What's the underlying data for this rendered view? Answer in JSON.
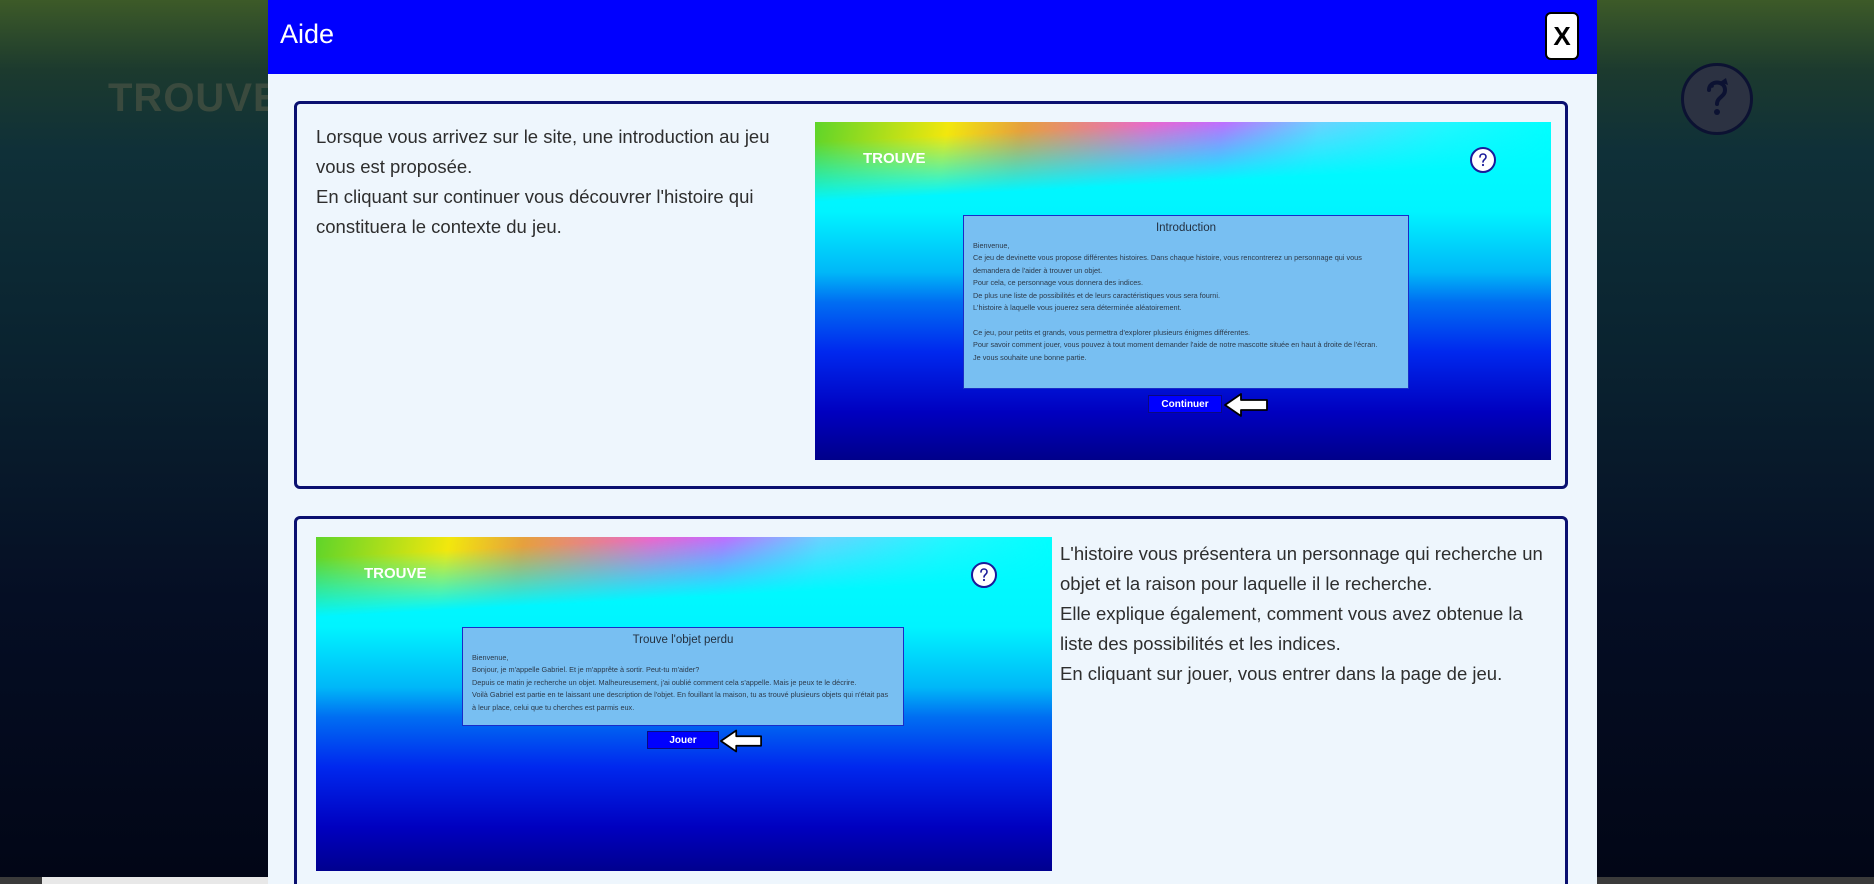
{
  "background": {
    "title": "TROUVE"
  },
  "modal": {
    "title": "Aide",
    "close_label": "X"
  },
  "sections": [
    {
      "paragraphs": [
        "Lorsque vous arrivez sur le site, une introduction au jeu vous est proposée.",
        "En cliquant sur continuer vous découvrer l'histoire qui constituera le contexte du jeu."
      ],
      "screenshot": {
        "brand": "TROUVE",
        "dialog_title": "Introduction",
        "dialog_lines": [
          "Bienvenue,",
          "Ce jeu de devinette vous propose différentes histoires. Dans chaque histoire, vous rencontrerez un personnage qui vous demandera de l'aider à trouver un objet.",
          "Pour cela, ce personnage vous donnera des indices.",
          "De plus une liste de possibilités et de leurs caractéristiques vous sera fourni.",
          "L'histoire à laquelle vous jouerez sera déterminée aléatoirement.",
          "",
          "Ce jeu, pour petits et grands, vous permettra d'explorer plusieurs énigmes différentes.",
          "Pour savoir comment jouer, vous pouvez à tout moment demander l'aide de notre mascotte située en haut à droite de l'écran.",
          "Je vous souhaite une bonne partie."
        ],
        "button_label": "Continuer"
      }
    },
    {
      "paragraphs": [
        "L'histoire vous présentera un personnage qui recherche un objet et la raison pour laquelle il le recherche.",
        "Elle explique également, comment vous avez obtenue la liste des possibilités et les indices.",
        "En cliquant sur jouer, vous entrer dans la page de jeu."
      ],
      "screenshot": {
        "brand": "TROUVE",
        "dialog_title": "Trouve l'objet perdu",
        "dialog_lines": [
          "Bienvenue,",
          "Bonjour, je m'appelle Gabriel. Et je m'apprête à sortir. Peut-tu m'aider?",
          "Depuis ce matin je recherche un objet. Malheureusement, j'ai oublié comment cela s'appelle. Mais je peux te le décrire.",
          "Voilà Gabriel est partie en te laissant une description de l'objet. En fouillant la maison, tu as trouvé plusieurs objets qui n'était pas à leur place, celui que tu cherches est parmis eux."
        ],
        "button_label": "Jouer"
      }
    }
  ],
  "icons": {
    "help": "mascot-help-icon",
    "arrow": "white-arrow-left-icon"
  },
  "colors": {
    "header": "#0000ff",
    "modal_bg": "#eef6fd",
    "card_border": "#0a1070",
    "dialog_bg": "#78bff2",
    "button_bg": "#0000ff"
  }
}
